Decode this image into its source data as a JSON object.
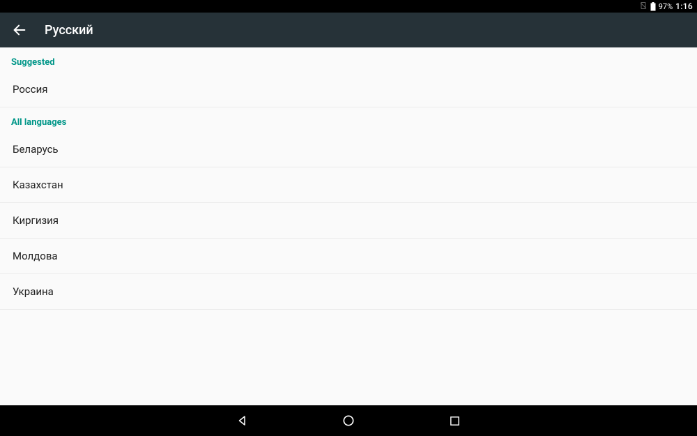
{
  "status": {
    "battery_pct": "97%",
    "time": "1:16"
  },
  "header": {
    "title": "Русский"
  },
  "sections": {
    "suggested": {
      "label": "Suggested",
      "items": [
        "Россия"
      ]
    },
    "all": {
      "label": "All languages",
      "items": [
        "Беларусь",
        "Казахстан",
        "Киргизия",
        "Молдова",
        "Украина"
      ]
    }
  }
}
